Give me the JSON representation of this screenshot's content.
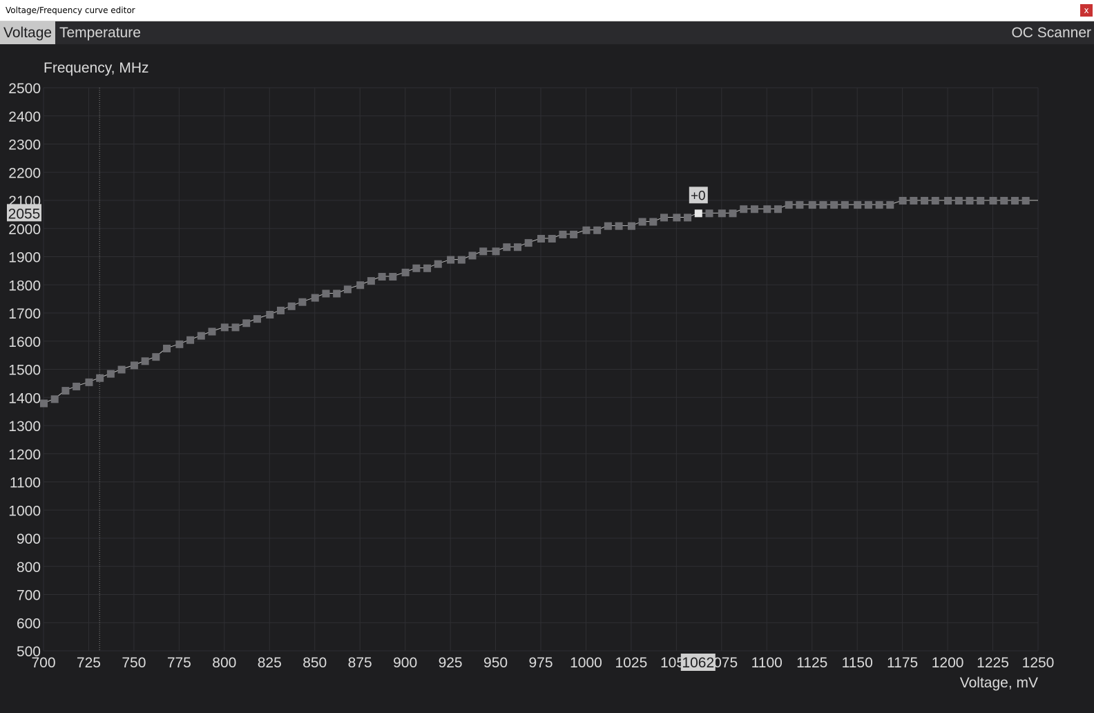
{
  "window": {
    "title": "Voltage/Frequency curve editor",
    "close_label": "x"
  },
  "tabs": [
    {
      "label": "Voltage",
      "active": true
    },
    {
      "label": "Temperature",
      "active": false
    }
  ],
  "oc_scanner_label": "OC Scanner",
  "colors": {
    "background": "#1e1e20",
    "grid": "#2f2f33",
    "point": "#6e6e72",
    "selected_point": "#e8e8e8",
    "text": "#dcdcdc",
    "highlight_box": "#d0d0d0"
  },
  "chart_data": {
    "type": "scatter",
    "ylabel": "Frequency, MHz",
    "xlabel": "Voltage, mV",
    "xlim": [
      700,
      1250
    ],
    "ylim": [
      500,
      2500
    ],
    "x_ticks": [
      700,
      725,
      750,
      775,
      800,
      825,
      850,
      875,
      900,
      925,
      950,
      975,
      1000,
      1025,
      1050,
      1075,
      1100,
      1125,
      1150,
      1175,
      1200,
      1225,
      1250
    ],
    "y_ticks": [
      2500,
      2400,
      2300,
      2200,
      2100,
      2000,
      1900,
      1800,
      1700,
      1600,
      1500,
      1400,
      1300,
      1200,
      1100,
      1000,
      900,
      800,
      700,
      600,
      500
    ],
    "cursor_voltage": 731,
    "selected": {
      "voltage": 1062,
      "voltage_label": "1062",
      "frequency": 2055,
      "frequency_label": "2055",
      "offset_label": "+0"
    },
    "series": [
      {
        "x": [
          700,
          706,
          712,
          718,
          725,
          731,
          737,
          743,
          750,
          756,
          762,
          768,
          775,
          781,
          787,
          793,
          800,
          806,
          812,
          818,
          825,
          831,
          837,
          843,
          850,
          856,
          862,
          868,
          875,
          881,
          887,
          893,
          900,
          906,
          912,
          918,
          925,
          931,
          937,
          943,
          950,
          956,
          962,
          968,
          975,
          981,
          987,
          993,
          1000,
          1006,
          1012,
          1018,
          1025,
          1031,
          1037,
          1043,
          1050,
          1056,
          1062,
          1068,
          1075,
          1081,
          1087,
          1093,
          1100,
          1106,
          1112,
          1118,
          1125,
          1131,
          1137,
          1143,
          1150,
          1156,
          1162,
          1168,
          1175,
          1181,
          1187,
          1193,
          1200,
          1206,
          1212,
          1218,
          1225,
          1231,
          1237,
          1243
        ],
        "y": [
          1380,
          1395,
          1425,
          1440,
          1455,
          1470,
          1485,
          1500,
          1515,
          1530,
          1545,
          1575,
          1590,
          1605,
          1620,
          1635,
          1650,
          1650,
          1665,
          1680,
          1695,
          1710,
          1725,
          1740,
          1755,
          1770,
          1770,
          1785,
          1800,
          1815,
          1830,
          1830,
          1845,
          1860,
          1860,
          1875,
          1890,
          1890,
          1905,
          1920,
          1920,
          1935,
          1935,
          1950,
          1965,
          1965,
          1980,
          1980,
          1995,
          1995,
          2010,
          2010,
          2010,
          2025,
          2025,
          2040,
          2040,
          2040,
          2055,
          2055,
          2055,
          2055,
          2070,
          2070,
          2070,
          2070,
          2085,
          2085,
          2085,
          2085,
          2085,
          2085,
          2085,
          2085,
          2085,
          2085,
          2100,
          2100,
          2100,
          2100,
          2100,
          2100,
          2100,
          2100,
          2100,
          2100,
          2100,
          2100
        ]
      }
    ]
  }
}
